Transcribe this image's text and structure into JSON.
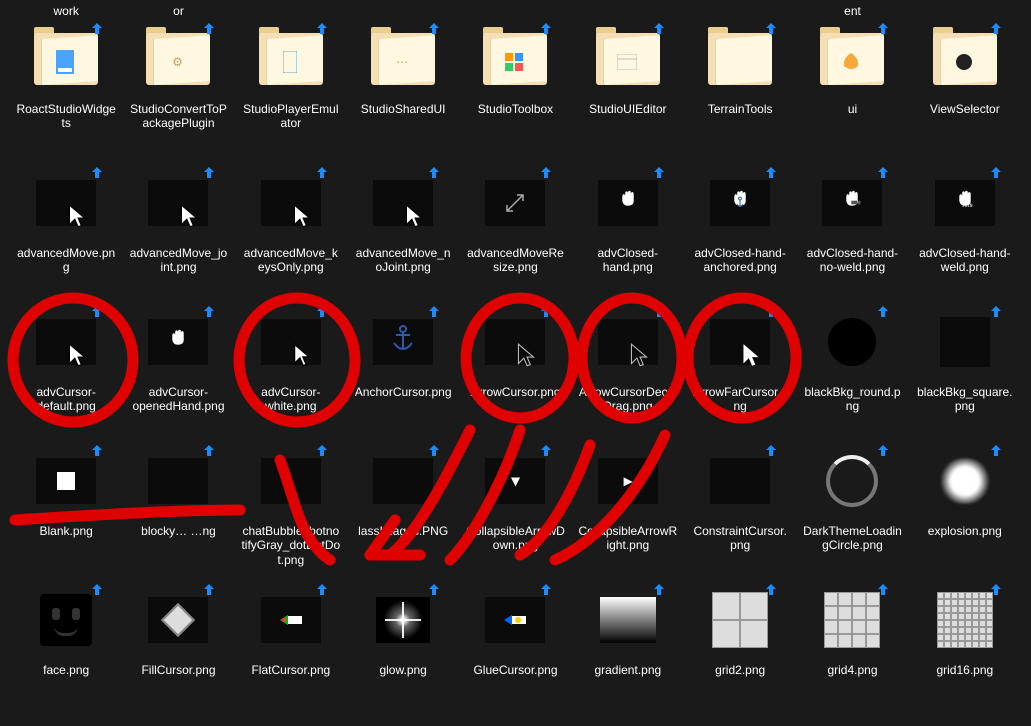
{
  "top_labels": [
    "work",
    "or",
    "",
    "",
    "",
    "",
    "",
    "ent",
    ""
  ],
  "folders": [
    {
      "name": "RoactStudioWidgets",
      "hint": "page"
    },
    {
      "name": "StudioConvertToPackagePlugin",
      "hint": "gear"
    },
    {
      "name": "StudioPlayerEmulator",
      "hint": "phone"
    },
    {
      "name": "StudioSharedUI",
      "hint": "dots"
    },
    {
      "name": "StudioToolbox",
      "hint": "tools"
    },
    {
      "name": "StudioUIEditor",
      "hint": "ui"
    },
    {
      "name": "TerrainTools",
      "hint": ""
    },
    {
      "name": "ui",
      "hint": "splash"
    },
    {
      "name": "ViewSelector",
      "hint": "cube"
    }
  ],
  "row2": [
    {
      "name": "advancedMove.png",
      "icon": "arrow-outline"
    },
    {
      "name": "advancedMove_joint.png",
      "icon": "arrow-small"
    },
    {
      "name": "advancedMove_keysOnly.png",
      "icon": "arrow-small"
    },
    {
      "name": "advancedMove_noJoint.png",
      "icon": "arrow-small"
    },
    {
      "name": "advancedMoveResize.png",
      "icon": "resize"
    },
    {
      "name": "advClosed-hand.png",
      "icon": "hand"
    },
    {
      "name": "advClosed-hand-anchored.png",
      "icon": "hand-anchor"
    },
    {
      "name": "advClosed-hand-no-weld.png",
      "icon": "hand-noweld"
    },
    {
      "name": "advClosed-hand-weld.png",
      "icon": "hand-weld"
    }
  ],
  "row3": [
    {
      "name": "advCursor-default.png",
      "icon": "arrow-outline"
    },
    {
      "name": "advCursor-openedHand.png",
      "icon": "open-hand"
    },
    {
      "name": "advCursor-white.png",
      "icon": "arrow-outline-bold"
    },
    {
      "name": "AnchorCursor.png",
      "icon": "anchor"
    },
    {
      "name": "ArrowCursor.png",
      "icon": "arrow-thin"
    },
    {
      "name": "ArrowCursorDecalDrag.png",
      "icon": "arrow-thin"
    },
    {
      "name": "ArrowFarCursor.png",
      "icon": "arrow-solid"
    },
    {
      "name": "blackBkg_round.png",
      "icon": "round-black"
    },
    {
      "name": "blackBkg_square.png",
      "icon": "square-black"
    }
  ],
  "row4": [
    {
      "name": "Blank.png",
      "icon": "white-square"
    },
    {
      "name": "blocky… …ng",
      "icon": "blank"
    },
    {
      "name": "chatBubble_botnotifyGray_dotDotDot.png",
      "icon": "blank"
    },
    {
      "name": "lassImages.PNG",
      "icon": "blank"
    },
    {
      "name": "CollapsibleArrowDown.png",
      "icon": "chevron-down"
    },
    {
      "name": "CollapsibleArrowRight.png",
      "icon": "chevron-right"
    },
    {
      "name": "ConstraintCursor.png",
      "icon": "blank"
    },
    {
      "name": "DarkThemeLoadingCircle.png",
      "icon": "loading"
    },
    {
      "name": "explosion.png",
      "icon": "explosion"
    }
  ],
  "row5": [
    {
      "name": "face.png",
      "icon": "face"
    },
    {
      "name": "FillCursor.png",
      "icon": "diamond"
    },
    {
      "name": "FlatCursor.png",
      "icon": "flat-cursor"
    },
    {
      "name": "glow.png",
      "icon": "glow"
    },
    {
      "name": "GlueCursor.png",
      "icon": "glue"
    },
    {
      "name": "gradient.png",
      "icon": "gradient"
    },
    {
      "name": "grid2.png",
      "icon": "grid2"
    },
    {
      "name": "grid4.png",
      "icon": "grid4"
    },
    {
      "name": "grid16.png",
      "icon": "grid16"
    }
  ],
  "circled_items": [
    "advCursor-default.png",
    "advCursor-white.png",
    "ArrowCursor.png",
    "ArrowCursorDecalDrag.png",
    "ArrowFarCursor.png"
  ],
  "colors": {
    "badge": "#1a8cff",
    "folder_back": "#f2d98c",
    "folder_front": "#fff9e6",
    "annotation": "#e00000"
  }
}
